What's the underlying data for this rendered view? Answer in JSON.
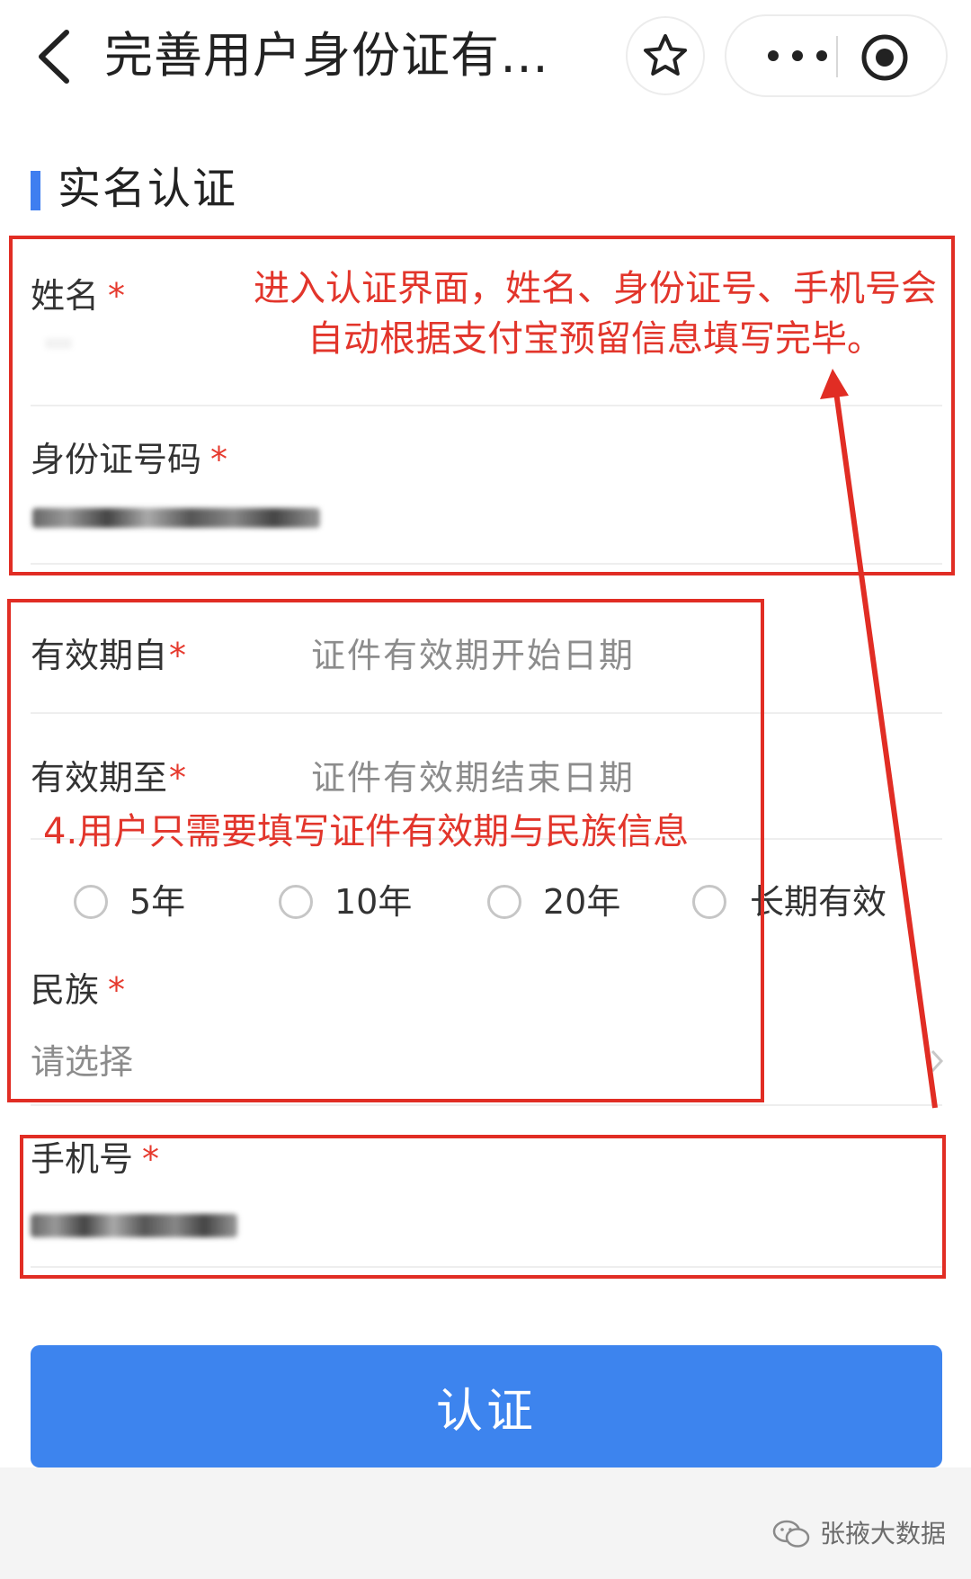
{
  "header": {
    "title": "完善用户身份证有…",
    "back_icon": "chevron-left-icon",
    "favorite_icon": "star-icon",
    "more_icon": "more-dots-icon",
    "close_icon": "target-circle-icon"
  },
  "section": {
    "title": "实名认证",
    "accent_color": "#3f7ef0"
  },
  "form": {
    "name": {
      "label": "姓名",
      "required_mark": "*"
    },
    "id_number": {
      "label": "身份证号码",
      "required_mark": "*"
    },
    "valid_from": {
      "label": "有效期自",
      "required_mark": "*",
      "placeholder": "证件有效期开始日期"
    },
    "valid_to": {
      "label": "有效期至",
      "required_mark": "*",
      "placeholder": "证件有效期结束日期"
    },
    "validity_options": [
      "5年",
      "10年",
      "20年",
      "长期有效"
    ],
    "ethnicity": {
      "label": "民族",
      "required_mark": "*",
      "placeholder": "请选择",
      "chevron_icon": "chevron-right-icon"
    },
    "phone": {
      "label": "手机号",
      "required_mark": "*"
    }
  },
  "annotations": {
    "top_line1": "进入认证界面，姓名、身份证号、手机号会",
    "top_line2": "自动根据支付宝预留信息填写完毕。",
    "middle": "4.用户只需要填写证件有效期与民族信息",
    "color": "#e12d24"
  },
  "submit": {
    "label": "认证",
    "color": "#3d84ee"
  },
  "watermark": {
    "text": "张掖大数据",
    "icon": "wechat-icon"
  }
}
